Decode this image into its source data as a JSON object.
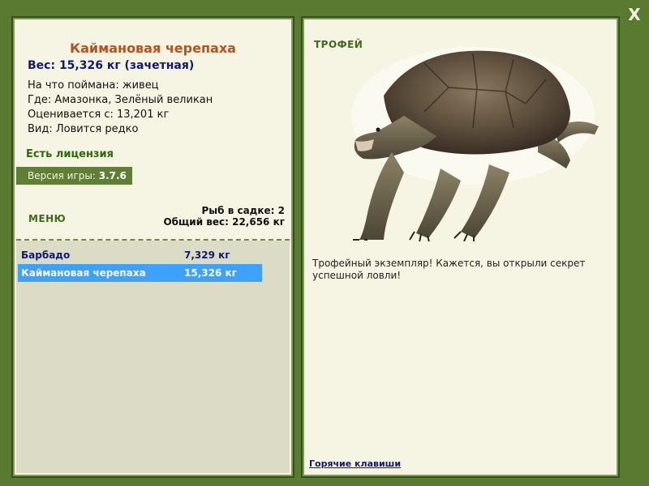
{
  "window": {
    "close_label": "X"
  },
  "fish": {
    "name": "Каймановая черепаха",
    "weight_line": "Вес: 15,326 кг (зачетная)",
    "bait_line": "На что поймана: живец",
    "where_line": "Где: Амазонка, Зелёный великан",
    "valued_line": "Оценивается с: 13,201 кг",
    "kind_line": "Вид: Ловится редко"
  },
  "license": "Есть лицензия",
  "version": {
    "label": "Версия игры:",
    "value": "3.7.6"
  },
  "menu_label": "МЕНЮ",
  "stats": {
    "in_keepnet": "Рыб в садке: 2",
    "total_weight": "Общий вес: 22,656 кг"
  },
  "catch_list": [
    {
      "name": "Барбадо",
      "weight": "7,329 кг",
      "selected": false
    },
    {
      "name": "Каймановая черепаха",
      "weight": "15,326 кг",
      "selected": true
    }
  ],
  "trophy": {
    "label": "ТРОФЕЙ",
    "message": "Трофейный экземпляр! Кажется, вы открыли секрет успешной ловли!"
  },
  "hotkeys_link": "Горячие клавиши",
  "colors": {
    "background": "#5a7a32",
    "panel": "#f6f4e2",
    "title": "#b4531e",
    "accent_blue": "#0e1a73",
    "selection": "#3ea0ff"
  }
}
